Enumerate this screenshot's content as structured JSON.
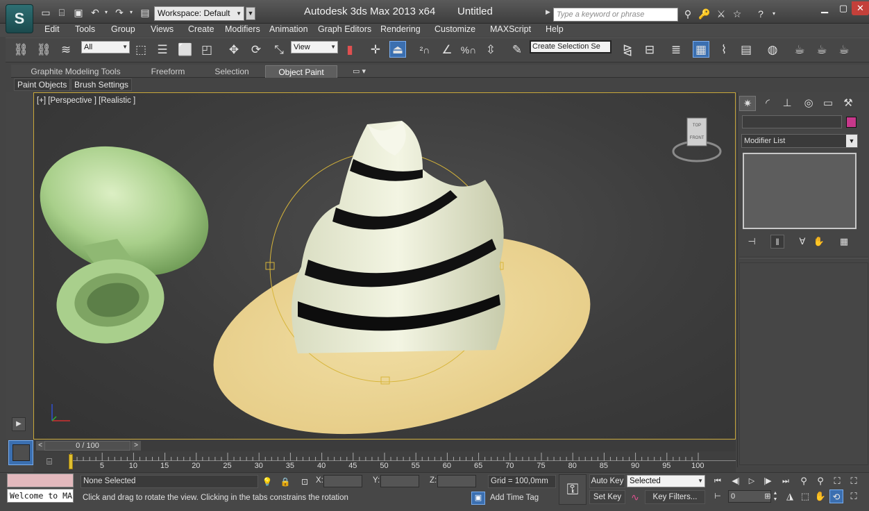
{
  "window": {
    "app_title": "Autodesk 3ds Max  2013 x64",
    "doc_title": "Untitled",
    "workspace": "Workspace: Default",
    "search_placeholder": "Type a keyword or phrase"
  },
  "menu": [
    "Edit",
    "Tools",
    "Group",
    "Views",
    "Create",
    "Modifiers",
    "Animation",
    "Graph Editors",
    "Rendering",
    "Customize",
    "MAXScript",
    "Help"
  ],
  "toolbar": {
    "filter": "All",
    "coord_system": "View",
    "selection_set": "Create Selection Se"
  },
  "ribbon": {
    "tabs": [
      "Graphite Modeling Tools",
      "Freeform",
      "Selection",
      "Object Paint"
    ],
    "active_tab": "Object Paint",
    "sub_buttons": [
      "Paint Objects",
      "Brush Settings"
    ]
  },
  "viewport": {
    "label": "[+] [Perspective ] [Realistic ]",
    "viewcube_top": "TOP",
    "viewcube_front": "FRONT"
  },
  "command_panel": {
    "modifier_list": "Modifier List",
    "object_color": "#c7388b"
  },
  "timeline": {
    "frame_display": "0 / 100",
    "ticks": [
      "5",
      "10",
      "15",
      "20",
      "25",
      "30",
      "35",
      "40",
      "45",
      "50",
      "55",
      "60",
      "65",
      "70",
      "75",
      "80",
      "85",
      "90",
      "95",
      "100"
    ]
  },
  "status": {
    "listener_text": "Welcome to MA",
    "selection": "None Selected",
    "prompt": "Click and drag to rotate the view.  Clicking in the tabs constrains the rotation",
    "x_label": "X:",
    "y_label": "Y:",
    "z_label": "Z:",
    "grid": "Grid = 100,0mm",
    "add_time_tag": "Add Time Tag",
    "auto_key": "Auto Key",
    "set_key": "Set Key",
    "key_mode": "Selected",
    "key_filters": "Key Filters...",
    "current_frame": "0"
  },
  "colors": {
    "accent": "#3b6fb0",
    "viewport_border": "#c9a83a",
    "close_button": "#c4403a"
  }
}
